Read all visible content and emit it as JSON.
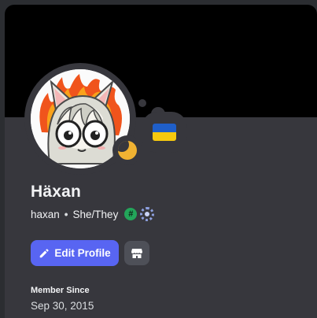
{
  "profile": {
    "display_name": "Häxan",
    "username": "haxan",
    "separator": "•",
    "pronouns": "She/They",
    "status": "idle",
    "custom_status_emoji": "ukraine-flag"
  },
  "badges": [
    {
      "name": "hashtag-badge",
      "glyph": "#"
    },
    {
      "name": "gear-badge",
      "glyph": ""
    }
  ],
  "actions": {
    "edit_profile_label": "Edit Profile",
    "shop_icon": "shop-icon"
  },
  "member_since": {
    "label": "Member Since",
    "date": "Sep 30, 2015"
  },
  "colors": {
    "background": "#37373d",
    "banner": "#000000",
    "accent": "#5865f2",
    "idle": "#f0b232"
  }
}
